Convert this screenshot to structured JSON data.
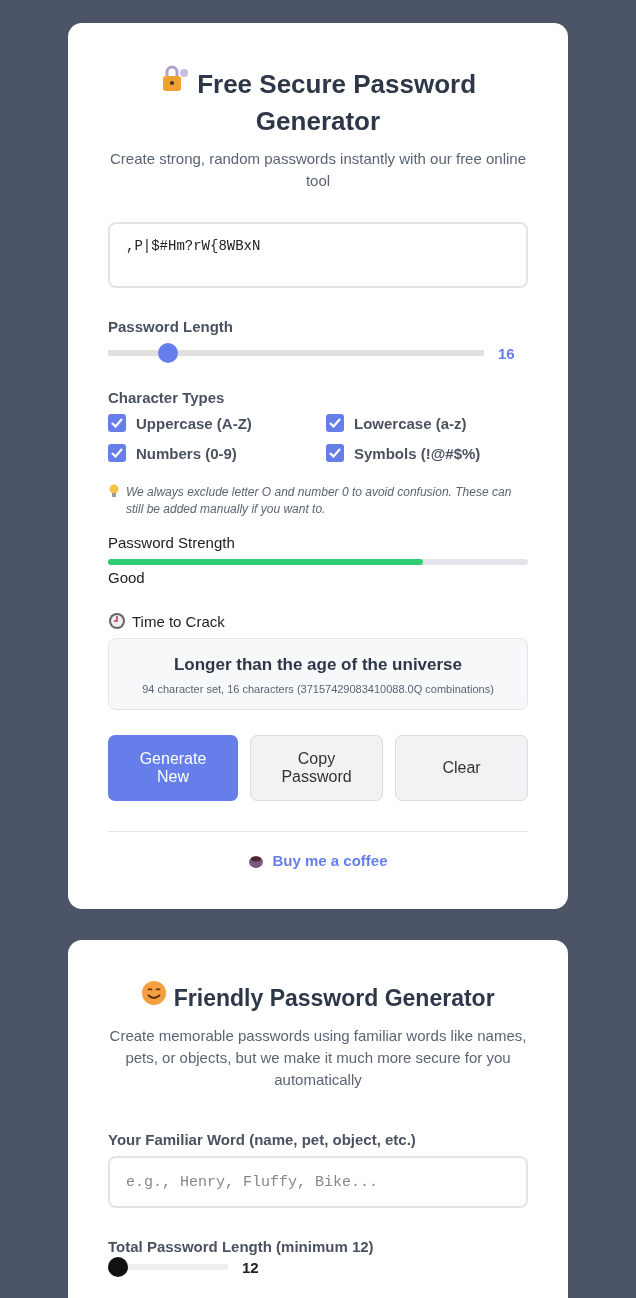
{
  "secure_generator": {
    "title": "Free Secure Password Generator",
    "subtitle": "Create strong, random passwords instantly with our free online tool",
    "password": ",P|$#Hm?rW{8WBxN",
    "length": {
      "label": "Password Length",
      "level": 0.16,
      "value": "16"
    },
    "character_types": {
      "label": "Character Types",
      "options": [
        {
          "label": "Uppercase (A-Z)",
          "checked": true
        },
        {
          "label": "Lowercase (a-z)",
          "checked": true
        },
        {
          "label": "Numbers (0-9)",
          "checked": true
        },
        {
          "label": "Symbols (!@#$%)",
          "checked": true
        }
      ]
    },
    "note": "We always exclude letter O and number 0 to avoid confusion. These can still be added manually if you want to.",
    "strength": {
      "label": "Password Strength",
      "level": 0.75,
      "rating": "Good"
    },
    "time_to_crack": {
      "label": "Time to Crack",
      "result": "Longer than the age of the universe",
      "detail": "94 character set, 16 characters (37157429083410088.0Q combinations)"
    },
    "buttons": [
      {
        "label": "Generate New",
        "kind": "primary"
      },
      {
        "label": "Copy Password",
        "kind": "secondary"
      },
      {
        "label": "Clear",
        "kind": "secondary"
      }
    ],
    "coffee_link": "Buy me a coffee"
  },
  "friendly_generator": {
    "title": "Friendly Password Generator",
    "subtitle": "Create memorable passwords using familiar words like names, pets, or objects, but we make it much more secure for you automatically",
    "word_field": {
      "label": "Your Familiar Word (name, pet, object, etc.)",
      "placeholder": "e.g., Henry, Fluffy, Bike..."
    },
    "total_length": {
      "label": "Total Password Length (minimum 12)",
      "level": 0,
      "value": "12"
    }
  }
}
